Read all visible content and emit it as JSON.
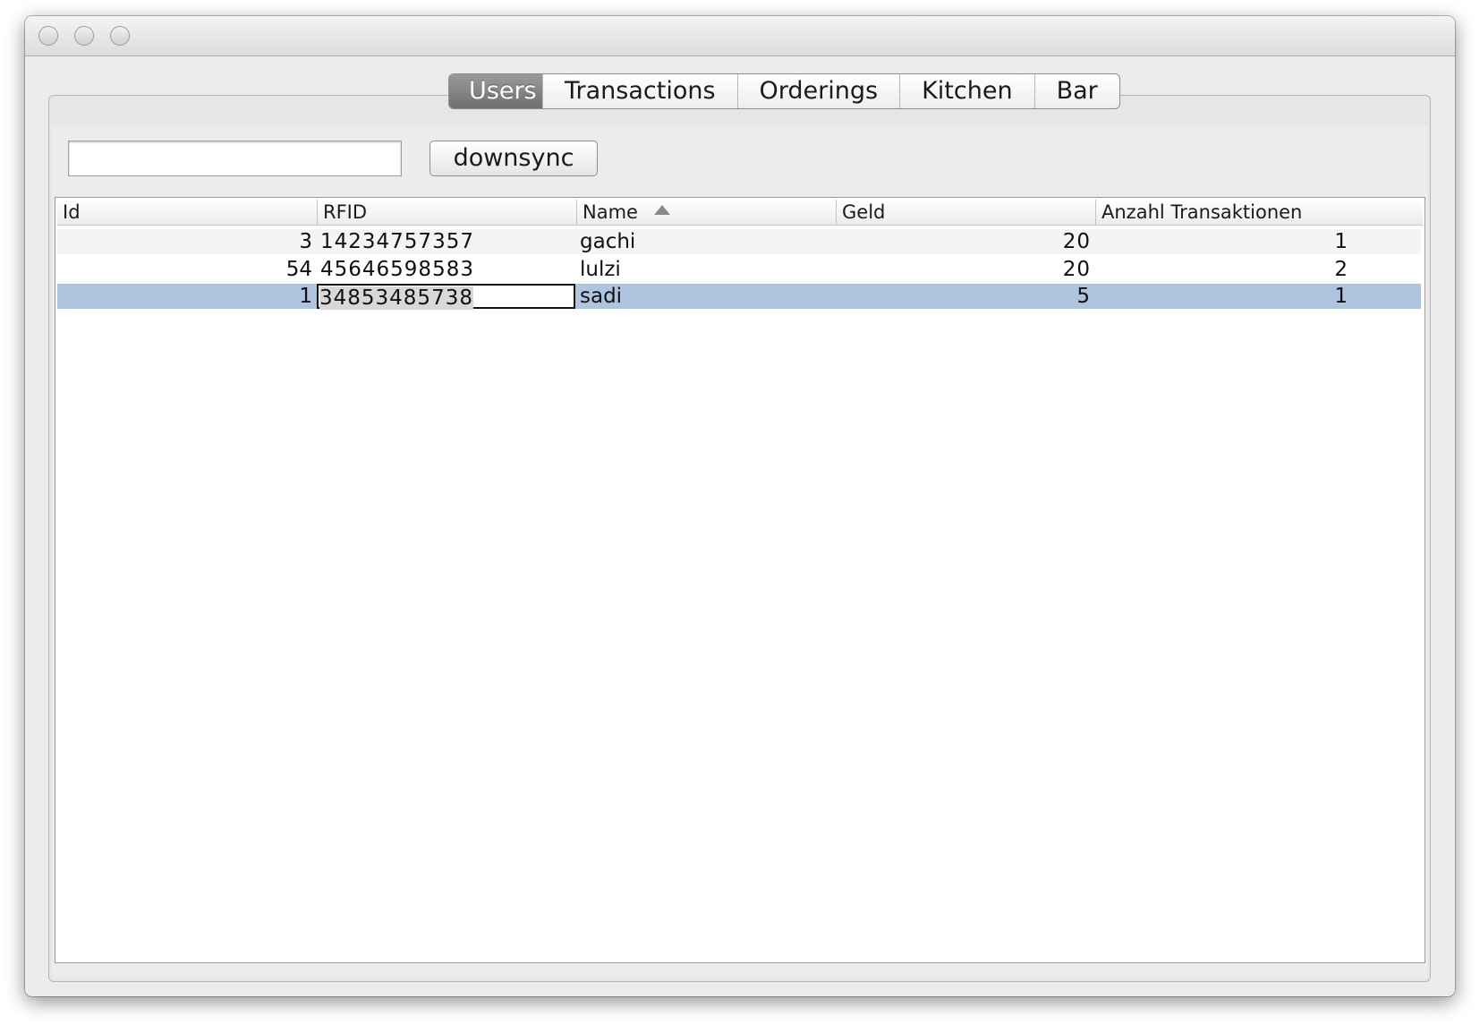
{
  "tabs": [
    {
      "label": "Users",
      "active": true
    },
    {
      "label": "Transactions",
      "active": false
    },
    {
      "label": "Orderings",
      "active": false
    },
    {
      "label": "Kitchen",
      "active": false
    },
    {
      "label": "Bar",
      "active": false
    }
  ],
  "search": {
    "value": "",
    "placeholder": ""
  },
  "toolbar": {
    "downsync_label": "downsync"
  },
  "table": {
    "columns": [
      "Id",
      "RFID",
      "Name",
      "Geld",
      "Anzahl Transaktionen"
    ],
    "sorted_column": "Name",
    "sort_direction": "ascending",
    "rows": [
      {
        "id": "3",
        "rfid": "14234757357",
        "name": "gachi",
        "geld": "20",
        "anzahl": "1"
      },
      {
        "id": "54",
        "rfid": "45646598583",
        "name": "lulzi",
        "geld": "20",
        "anzahl": "2"
      },
      {
        "id": "1",
        "rfid": "34853485738",
        "name": "sadi",
        "geld": "5",
        "anzahl": "1"
      }
    ],
    "selected_row": 2,
    "editing_cell": "rfid"
  },
  "colors": {
    "selection": "#afc4de",
    "active_tab": "#7f7f7f",
    "window_bg": "#ececec"
  }
}
